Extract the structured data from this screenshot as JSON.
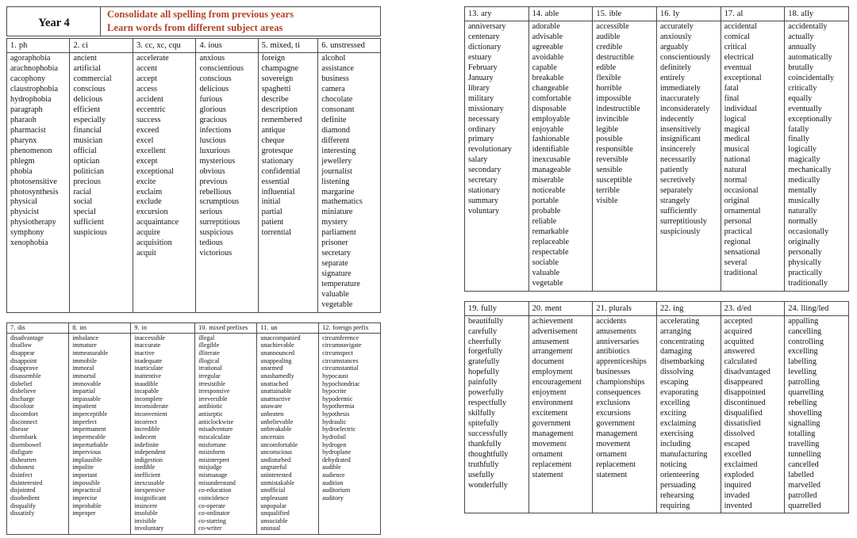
{
  "banner": {
    "year_label": "Year 4",
    "line1": "Consolidate all spelling from previous years",
    "line2": "Learn words from different subject areas"
  },
  "groups": [
    {
      "index": "1.",
      "title": "ph",
      "words": [
        "agoraphobia",
        "arachnophobia",
        "cacophony",
        "claustrophobia",
        "hydrophobia",
        "paragraph",
        "pharaoh",
        "pharmacist",
        "pharynx",
        "phenomenon",
        "phlegm",
        "phobia",
        "photosensitive",
        "photosynthesis",
        "physical",
        "physicist",
        "physiotherapy",
        "symphony",
        "xenophobia"
      ]
    },
    {
      "index": "2.",
      "title": "ci",
      "words": [
        "ancient",
        "artificial",
        "commercial",
        "conscious",
        "delicious",
        "efficient",
        "especially",
        "financial",
        "musician",
        "official",
        "optician",
        "politician",
        "precious",
        "racial",
        "social",
        "special",
        "sufficient",
        "suspicious"
      ]
    },
    {
      "index": "3.",
      "title": "cc, xc, cqu",
      "words": [
        "accelerate",
        "accent",
        "accept",
        "access",
        "accident",
        "eccentric",
        "success",
        "exceed",
        "excel",
        "excellent",
        "except",
        "exceptional",
        "excite",
        "exclaim",
        "exclude",
        "excursion",
        "acquaintance",
        "acquire",
        "acquisition",
        "acquit"
      ]
    },
    {
      "index": "4.",
      "title": "ious",
      "words": [
        "anxious",
        "conscientious",
        "conscious",
        "delicious",
        "furious",
        "glorious",
        "gracious",
        "infections",
        "luscious",
        "luxurious",
        "mysterious",
        "obvious",
        "previous",
        "rebellious",
        "scrumptious",
        "serious",
        "surreptitious",
        "suspicious",
        "tedious",
        "victorious"
      ]
    },
    {
      "index": "5.",
      "title": "mixed, ti",
      "words": [
        "foreign",
        "champagne",
        "sovereign",
        "spaghetti",
        "describe",
        "description",
        "remembered",
        "antique",
        "cheque",
        "grotesque",
        "stationary",
        "confidential",
        "essential",
        "influential",
        "initial",
        "partial",
        "patient",
        "torrential"
      ]
    },
    {
      "index": "6.",
      "title": "unstressed",
      "words": [
        "alcohol",
        "assistance",
        "business",
        "camera",
        "chocolate",
        "consonant",
        "definite",
        "diamond",
        "different",
        "interesting",
        "jewellery",
        "journalist",
        "listening",
        "margarine",
        "mathematics",
        "miniature",
        "mystery",
        "parliament",
        "prisoner",
        "secretary",
        "separate",
        "signature",
        "temperature",
        "valuable",
        "vegetable"
      ]
    },
    {
      "index": "7.",
      "title": "dis",
      "words": [
        "disadvantage",
        "disallow",
        "disappear",
        "disappoint",
        "disapprove",
        "disassemble",
        "disbelief",
        "disbelieve",
        "discharge",
        "discolour",
        "discomfort",
        "disconnect",
        "disease",
        "disembark",
        "disembowel",
        "disfigure",
        "dishearten",
        "dishonest",
        "disinfect",
        "disinterested",
        "disjointed",
        "disobedient",
        "disqualify",
        "dissatisfy"
      ]
    },
    {
      "index": "8.",
      "title": "im",
      "words": [
        "imbalance",
        "immature",
        "immeasurable",
        "immobile",
        "immoral",
        "immortal",
        "immovable",
        "impartial",
        "impassable",
        "impatient",
        "imperceptible",
        "imperfect",
        "impermanent",
        "impermeable",
        "imperturbable",
        "impervious",
        "implausible",
        "impolite",
        "important",
        "impossible",
        "impractical",
        "imprecise",
        "improbable",
        "improper"
      ]
    },
    {
      "index": "9.",
      "title": "in",
      "words": [
        "inaccessible",
        "inaccurate",
        "inactive",
        "inadequate",
        "inarticulate",
        "inattentive",
        "inaudible",
        "incapable",
        "incomplete",
        "inconsiderate",
        "inconvenient",
        "incorrect",
        "incredible",
        "indecent",
        "indefinite",
        "independent",
        "indigestion",
        "inedible",
        "inefficient",
        "inexcusable",
        "inexpensive",
        "insignificant",
        "insincere",
        "insoluble",
        "invisible",
        "involuntary"
      ]
    },
    {
      "index": "10.",
      "title": "mixed prefixes",
      "words": [
        "illegal",
        "illegible",
        "illiterate",
        "illogical",
        "irrational",
        "irregular",
        "irresistible",
        "irresponsive",
        "irreversible",
        "antibiotic",
        "antiseptic",
        "anticlockwise",
        "misadventure",
        "miscalculate",
        "misfortune",
        "misinform",
        "misinterpret",
        "misjudge",
        "mismanage",
        "misunderstand",
        "co-education",
        "coincidence",
        "co-operate",
        "co-ordinator",
        "co-starring",
        "co-writer"
      ]
    },
    {
      "index": "11.",
      "title": "un",
      "words": [
        "unaccompanied",
        "unachievable",
        "unannounced",
        "unappealing",
        "unarmed",
        "unashamedly",
        "unattached",
        "unattainable",
        "unattractive",
        "unaware",
        "unbeaten",
        "unbelievable",
        "unbreakable",
        "uncertain",
        "uncomfortable",
        "unconscious",
        "undisturbed",
        "ungrateful",
        "uninterested",
        "unmistakable",
        "unofficial",
        "unpleasant",
        "unpopular",
        "unqualified",
        "unsociable",
        "unusual"
      ]
    },
    {
      "index": "12.",
      "title": "foreign prefix",
      "words": [
        "circumference",
        "circumnavigate",
        "circumspect",
        "circumstances",
        "circumstantial",
        "hypocaust",
        "hypochondriac",
        "hypocrite",
        "hypodermic",
        "hypothermia",
        "hypothesis",
        "hydraulic",
        "hydroelectric",
        "hydrofoil",
        "hydrogen",
        "hydroplane",
        "dehydrated",
        "audible",
        "audience",
        "audition",
        "auditorium",
        "auditory"
      ]
    },
    {
      "index": "13.",
      "title": "ary",
      "words": [
        "anniversary",
        "centenary",
        "dictionary",
        "estuary",
        "February",
        "January",
        "library",
        "military",
        "missionary",
        "necessary",
        "ordinary",
        "primary",
        "revolutionary",
        "salary",
        "secondary",
        "secretary",
        "stationary",
        "summary",
        "voluntary"
      ]
    },
    {
      "index": "14.",
      "title": "able",
      "words": [
        "adorable",
        "advisable",
        "agreeable",
        "avoidable",
        "capable",
        "breakable",
        "changeable",
        "comfortable",
        "disposable",
        "employable",
        "enjoyable",
        "fashionable",
        "identifiable",
        "inexcusable",
        "manageable",
        "miserable",
        "noticeable",
        "portable",
        "probable",
        "reliable",
        "remarkable",
        "replaceable",
        "respectable",
        "sociable",
        "valuable",
        "vegetable"
      ]
    },
    {
      "index": "15.",
      "title": "ible",
      "words": [
        "accessible",
        "audible",
        "credible",
        "destructible",
        "edible",
        "flexible",
        "horrible",
        "impossible",
        "indestructible",
        "invincible",
        "legible",
        "possible",
        "responsible",
        "reversible",
        "sensible",
        "susceptible",
        "terrible",
        "visible"
      ]
    },
    {
      "index": "16.",
      "title": "ly",
      "words": [
        "accurately",
        "anxiously",
        "arguably",
        "conscientiously",
        "definitely",
        "entirely",
        "immediately",
        "inaccurately",
        "inconsiderately",
        "indecently",
        "insensitively",
        "insignificant",
        "insincerely",
        "necessarily",
        "patiently",
        "secretively",
        "separately",
        "strangely",
        "sufficiently",
        "surreptitiously",
        "suspiciously"
      ]
    },
    {
      "index": "17.",
      "title": "al",
      "words": [
        "accidental",
        "comical",
        "critical",
        "electrical",
        "eventual",
        "exceptional",
        "fatal",
        "final",
        "individual",
        "logical",
        "magical",
        "medical",
        "musical",
        "national",
        "natural",
        "normal",
        "occasional",
        "original",
        "ornamental",
        "personal",
        "practical",
        "regional",
        "sensational",
        "several",
        "traditional"
      ]
    },
    {
      "index": "18.",
      "title": "ally",
      "words": [
        "accidentally",
        "actually",
        "annually",
        "automatically",
        "brutally",
        "coincidentally",
        "critically",
        "equally",
        "eventually",
        "exceptionally",
        "fatally",
        "finally",
        "logically",
        "magically",
        "mechanically",
        "medically",
        "mentally",
        "musically",
        "naturally",
        "normally",
        "occasionally",
        "originally",
        "personally",
        "physically",
        "practically",
        "traditionally"
      ]
    },
    {
      "index": "19.",
      "title": "fully",
      "words": [
        "beautifully",
        "carefully",
        "cheerfully",
        "forgetfully",
        "gratefully",
        "hopefully",
        "painfully",
        "powerfully",
        "respectfully",
        "skilfully",
        "spitefully",
        "successfully",
        "thankfully",
        "thoughtfully",
        "truthfully",
        "usefully",
        "wonderfully"
      ]
    },
    {
      "index": "20.",
      "title": "ment",
      "words": [
        "achievement",
        "advertisement",
        "amusement",
        "arrangement",
        "document",
        "employment",
        "encouragement",
        "enjoyment",
        "environment",
        "excitement",
        "government",
        "management",
        "movement",
        "ornament",
        "replacement",
        "statement"
      ]
    },
    {
      "index": "21.",
      "title": "plurals",
      "words": [
        "accidents",
        "amusements",
        "anniversaries",
        "antibiotics",
        "apprenticeships",
        "businesses",
        "championships",
        "consequences",
        "exclusions",
        "excursions",
        "government",
        "management",
        "movement",
        "ornament",
        "replacement",
        "statement"
      ]
    },
    {
      "index": "22.",
      "title": "ing",
      "words": [
        "accelerating",
        "arranging",
        "concentrating",
        "damaging",
        "disembarking",
        "dissolving",
        "escaping",
        "evaporating",
        "excelling",
        "exciting",
        "exclaiming",
        "exercising",
        "including",
        "manufacturing",
        "noticing",
        "orienteering",
        "persuading",
        "rehearsing",
        "requiring"
      ]
    },
    {
      "index": "23.",
      "title": "d/ed",
      "words": [
        "accepted",
        "acquired",
        "acquitted",
        "answered",
        "calculated",
        "disadvantaged",
        "disappeared",
        "disappointed",
        "discontinued",
        "disqualified",
        "dissatisfied",
        "dissolved",
        "escaped",
        "excelled",
        "exclaimed",
        "exploded",
        "inquired",
        "invaded",
        "invented"
      ]
    },
    {
      "index": "24.",
      "title": "lling/led",
      "words": [
        "appalling",
        "cancelling",
        "controlling",
        "excelling",
        "labelling",
        "levelling",
        "patrolling",
        "quarrelling",
        "rebelling",
        "shovelling",
        "signalling",
        "totalling",
        "travelling",
        "tunnelling",
        "cancelled",
        "labelled",
        "marvelled",
        "patrolled",
        "quarrelled"
      ]
    }
  ],
  "colors": {
    "banner_text": "#b5432a",
    "border": "#2c2c2c",
    "body_text": "#111111"
  }
}
